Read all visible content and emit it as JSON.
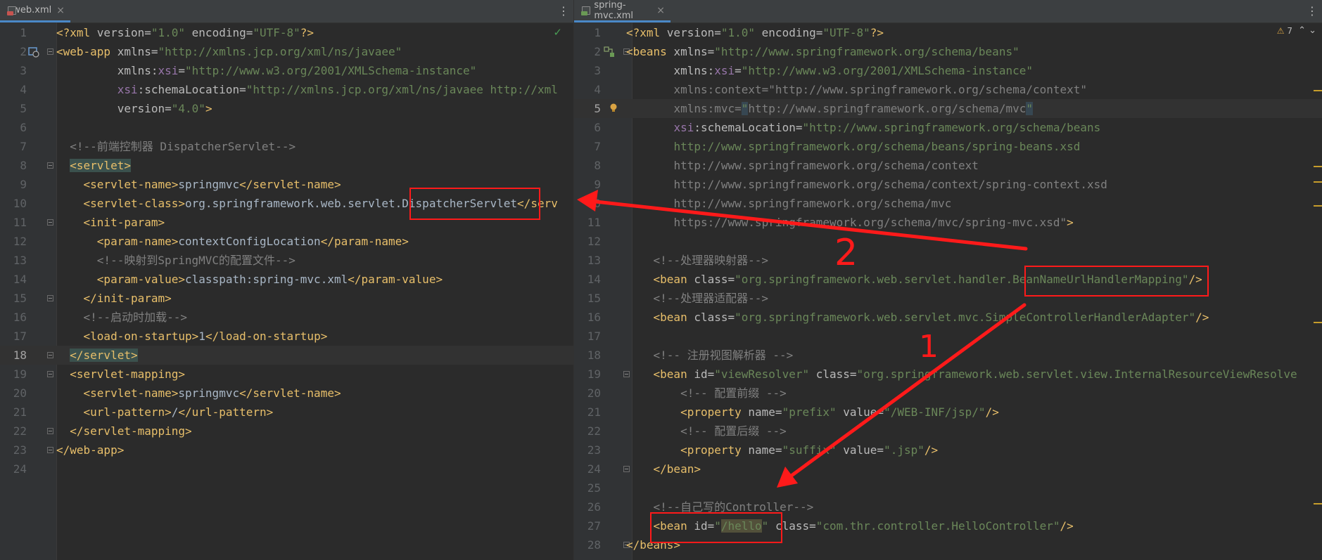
{
  "left_pane": {
    "tab": {
      "name": "web.xml",
      "close": "×"
    },
    "menu": "⋮",
    "status_check": "✓",
    "line_numbers": [
      "1",
      "2",
      "3",
      "4",
      "5",
      "6",
      "7",
      "8",
      "9",
      "10",
      "11",
      "12",
      "13",
      "14",
      "15",
      "16",
      "17",
      "18",
      "19",
      "20",
      "21",
      "22",
      "23",
      "24"
    ],
    "current_line": "18"
  },
  "right_pane": {
    "tab": {
      "name": "spring-mvc.xml",
      "close": "×"
    },
    "menu": "⋮",
    "warnings": {
      "icon": "⚠",
      "count": "7"
    },
    "nav_arrows": "⌃ ⌄",
    "line_numbers": [
      "1",
      "2",
      "3",
      "4",
      "5",
      "6",
      "7",
      "8",
      "9",
      "10",
      "11",
      "12",
      "13",
      "14",
      "15",
      "16",
      "17",
      "18",
      "19",
      "20",
      "21",
      "22",
      "23",
      "24",
      "25",
      "26",
      "27",
      "28"
    ],
    "current_line": "5"
  },
  "annotations": {
    "label_1": "1",
    "label_2": "2",
    "arrow_color": "#ff1a1a"
  },
  "colors": {
    "editor_bg": "#2b2b2b",
    "tag": "#e8bf6a",
    "attribute_value": "#6a8759",
    "comment": "#808080",
    "namespace": "#9876aa"
  },
  "icons": [
    "file-xml-icon",
    "file-spring-icon",
    "close-icon",
    "more-icon",
    "check-icon",
    "warning-icon",
    "chevron-up-icon",
    "chevron-down-icon",
    "bulb-icon",
    "web-app-icon",
    "bean-icon"
  ]
}
